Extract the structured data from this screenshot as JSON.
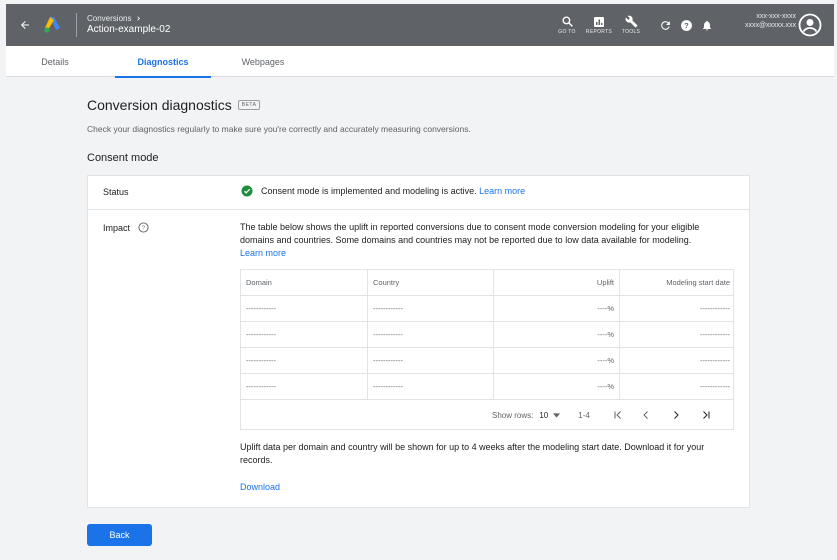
{
  "header": {
    "breadcrumb_parent": "Conversions",
    "breadcrumb_title": "Action-example-02",
    "tools": [
      {
        "icon": "search-icon",
        "label": "GO TO"
      },
      {
        "icon": "reports-icon",
        "label": "REPORTS"
      },
      {
        "icon": "wrench-icon",
        "label": "TOOLS"
      }
    ],
    "account_id": "xxx-xxx-xxxx",
    "account_email": "xxxx@xxxxx.xxx",
    "bg_color": "#5f6368"
  },
  "tabs": [
    {
      "label": "Details",
      "active": false
    },
    {
      "label": "Diagnostics",
      "active": true
    },
    {
      "label": "Webpages",
      "active": false
    }
  ],
  "page": {
    "title": "Conversion diagnostics",
    "beta_badge": "BETA",
    "subtitle": "Check your diagnostics regularly to make sure you're correctly and accurately measuring conversions.",
    "section_title": "Consent mode"
  },
  "card": {
    "status_label": "Status",
    "status_text": "Consent mode is implemented and modeling is active.",
    "status_link": "Learn more",
    "impact_label": "Impact",
    "impact_text": "The table below shows the uplift in reported conversions due to consent mode conversion modeling for your eligible domains and countries. Some domains and countries may not be reported due to low data available for modeling.",
    "impact_link": "Learn more",
    "table": {
      "headers": [
        "Domain",
        "Country",
        "Uplift",
        "Modeling start date"
      ],
      "rows": [
        [
          "------------",
          "------------",
          "----%",
          "------------"
        ],
        [
          "------------",
          "------------",
          "----%",
          "------------"
        ],
        [
          "------------",
          "------------",
          "----%",
          "------------"
        ],
        [
          "------------",
          "------------",
          "----%",
          "------------"
        ]
      ],
      "show_rows_label": "Show rows:",
      "rows_per_page": "10",
      "range": "1-4"
    },
    "note": "Uplift data per domain and country will be shown for up to 4 weeks after the modeling start date. Download it for your records.",
    "download_label": "Download"
  },
  "footer": {
    "back_label": "Back"
  },
  "colors": {
    "accent": "#1a73e8",
    "success": "#1e8e3e"
  }
}
